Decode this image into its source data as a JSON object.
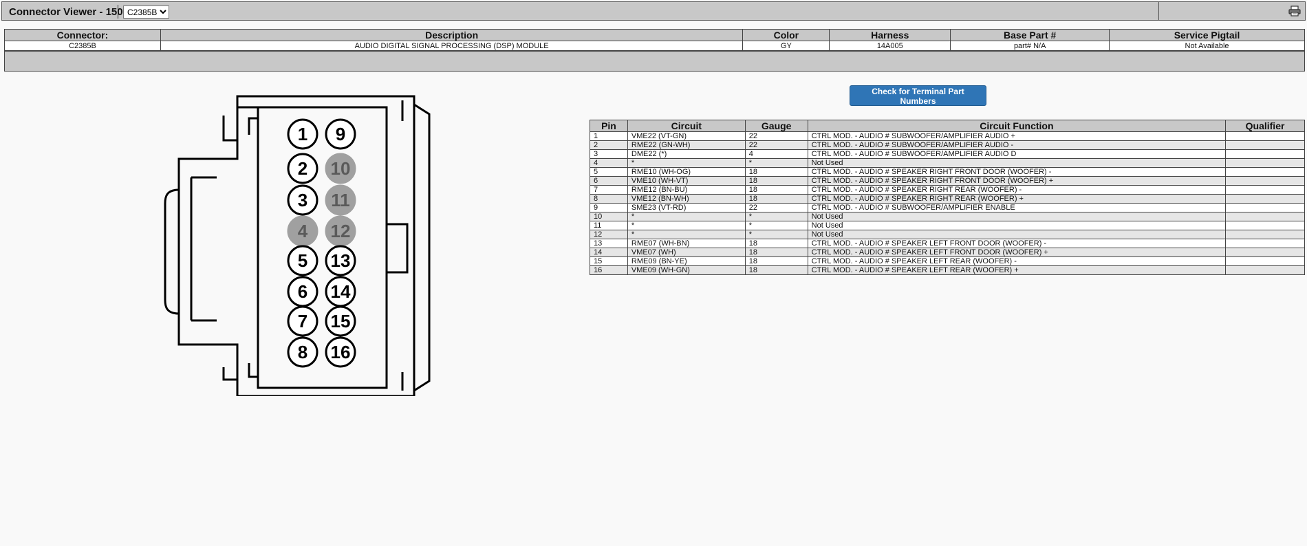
{
  "header": {
    "title": "Connector Viewer - 150",
    "selected_connector": "C2385B",
    "print_icon": "printer-icon"
  },
  "connector": {
    "columns": [
      "Connector:",
      "Description",
      "Color",
      "Harness",
      "Base Part #",
      "Service Pigtail"
    ],
    "row": [
      "C2385B",
      "AUDIO DIGITAL SIGNAL PROCESSING (DSP) MODULE",
      "GY",
      "14A005",
      "part# N/A",
      "Not Available"
    ]
  },
  "diagram": {
    "pins_left": [
      {
        "label": "1",
        "used": true
      },
      {
        "label": "2",
        "used": true
      },
      {
        "label": "3",
        "used": true
      },
      {
        "label": "4",
        "used": false
      },
      {
        "label": "5",
        "used": true
      },
      {
        "label": "6",
        "used": true
      },
      {
        "label": "7",
        "used": true
      },
      {
        "label": "8",
        "used": true
      }
    ],
    "pins_right": [
      {
        "label": "9",
        "used": true
      },
      {
        "label": "10",
        "used": false
      },
      {
        "label": "11",
        "used": false
      },
      {
        "label": "12",
        "used": false
      },
      {
        "label": "13",
        "used": true
      },
      {
        "label": "14",
        "used": true
      },
      {
        "label": "15",
        "used": true
      },
      {
        "label": "16",
        "used": true
      }
    ],
    "used_color": "#ffffff",
    "unused_color": "#a0a0a0"
  },
  "terminal_button": "Check for Terminal Part Numbers",
  "pin_table": {
    "columns": [
      "Pin",
      "Circuit",
      "Gauge",
      "Circuit Function",
      "Qualifier"
    ],
    "rows": [
      [
        "1",
        "VME22 (VT-GN)",
        "22",
        "CTRL MOD. - AUDIO # SUBWOOFER/AMPLIFIER AUDIO +",
        ""
      ],
      [
        "2",
        "RME22 (GN-WH)",
        "22",
        "CTRL MOD. - AUDIO # SUBWOOFER/AMPLIFIER AUDIO -",
        ""
      ],
      [
        "3",
        "DME22 (*)",
        "4",
        "CTRL MOD. - AUDIO # SUBWOOFER/AMPLIFIER AUDIO D",
        ""
      ],
      [
        "4",
        "*",
        "*",
        "Not Used",
        ""
      ],
      [
        "5",
        "RME10 (WH-OG)",
        "18",
        "CTRL MOD. - AUDIO # SPEAKER RIGHT FRONT DOOR (WOOFER) -",
        ""
      ],
      [
        "6",
        "VME10 (WH-VT)",
        "18",
        "CTRL MOD. - AUDIO # SPEAKER RIGHT FRONT DOOR (WOOFER) +",
        ""
      ],
      [
        "7",
        "RME12 (BN-BU)",
        "18",
        "CTRL MOD. - AUDIO # SPEAKER RIGHT REAR (WOOFER) -",
        ""
      ],
      [
        "8",
        "VME12 (BN-WH)",
        "18",
        "CTRL MOD. - AUDIO # SPEAKER RIGHT REAR (WOOFER) +",
        ""
      ],
      [
        "9",
        "SME23 (VT-RD)",
        "22",
        "CTRL MOD. - AUDIO # SUBWOOFER/AMPLIFIER ENABLE",
        ""
      ],
      [
        "10",
        "*",
        "*",
        "Not Used",
        ""
      ],
      [
        "11",
        "*",
        "*",
        "Not Used",
        ""
      ],
      [
        "12",
        "*",
        "*",
        "Not Used",
        ""
      ],
      [
        "13",
        "RME07 (WH-BN)",
        "18",
        "CTRL MOD. - AUDIO # SPEAKER LEFT FRONT DOOR (WOOFER) -",
        ""
      ],
      [
        "14",
        "VME07 (WH)",
        "18",
        "CTRL MOD. - AUDIO # SPEAKER LEFT FRONT DOOR (WOOFER) +",
        ""
      ],
      [
        "15",
        "RME09 (BN-YE)",
        "18",
        "CTRL MOD. - AUDIO # SPEAKER LEFT REAR (WOOFER) -",
        ""
      ],
      [
        "16",
        "VME09 (WH-GN)",
        "18",
        "CTRL MOD. - AUDIO # SPEAKER LEFT REAR (WOOFER) +",
        ""
      ]
    ]
  }
}
